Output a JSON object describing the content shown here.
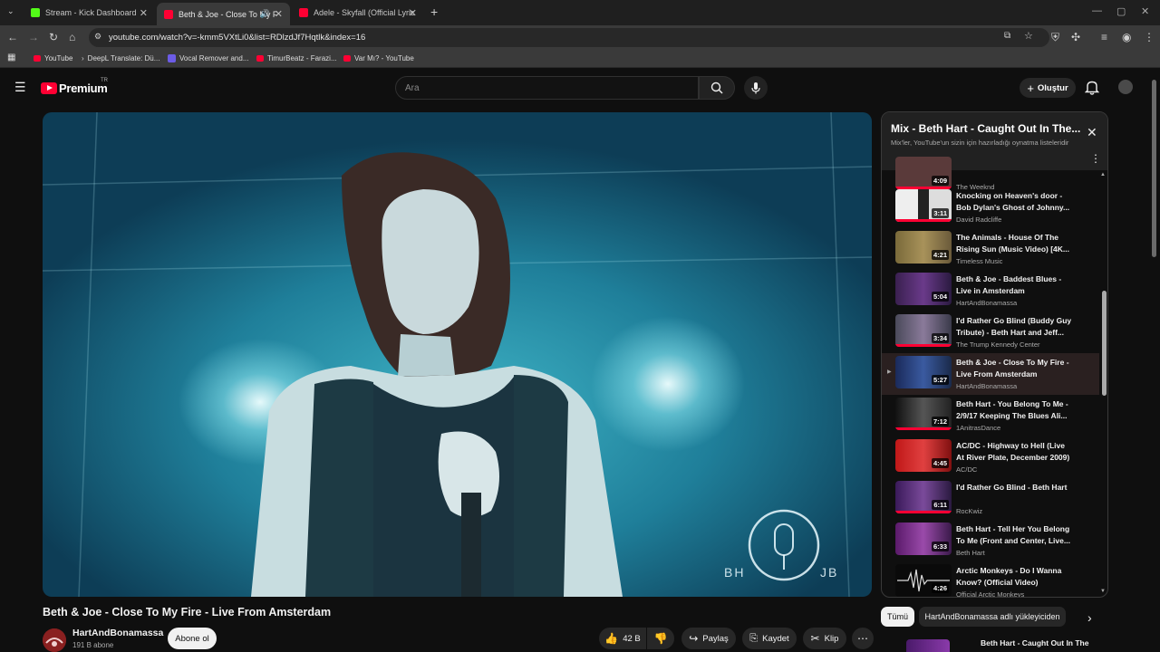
{
  "browser": {
    "tabs": [
      {
        "title": "Stream - Kick Dashboard",
        "favicon_color": "#53fc18"
      },
      {
        "title": "Beth & Joe - Close To My F",
        "favicon_color": "#ff0033"
      },
      {
        "title": "Adele - Skyfall (Official Lyric Vi",
        "favicon_color": "#ff0033"
      }
    ],
    "url": "youtube.com/watch?v=-kmm5VXtLi0&list=RDlzdJf7Hqtlk&index=16",
    "bookmarks": [
      {
        "label": "YouTube"
      },
      {
        "label": "DeepL Translate: Dü..."
      },
      {
        "label": "Vocal Remover and..."
      },
      {
        "label": "TimurBeatz - Farazi..."
      },
      {
        "label": "Var Mı? - YouTube"
      }
    ]
  },
  "header": {
    "logo_text": "Premium",
    "logo_region": "TR",
    "search_placeholder": "Ara",
    "create_label": "Oluştur"
  },
  "video": {
    "title": "Beth & Joe - Close To My Fire - Live From Amsterdam",
    "watermark_left": "BH",
    "watermark_right": "JB",
    "channel_name": "HartAndBonamassa",
    "subscribers": "191 B abone",
    "subscribe_label": "Abone ol",
    "likes": "42 B",
    "share_label": "Paylaş",
    "save_label": "Kaydet",
    "clip_label": "Klip"
  },
  "playlist": {
    "title": "Mix - Beth Hart - Caught Out In The...",
    "subtitle": "Mix'ler, YouTube'un sizin için hazırladığı oynatma listeleridir",
    "items": [
      {
        "title": "",
        "channel": "The Weeknd",
        "duration": "4:09",
        "thumb": "#5a3a3a"
      },
      {
        "title": "Knocking on Heaven's door - Bob Dylan's Ghost of Johnny...",
        "channel": "David Radcliffe",
        "duration": "3:11",
        "thumb": "#bfbfbf"
      },
      {
        "title": "The Animals - House Of The Rising Sun (Music Video) [4K...",
        "channel": "Timeless Music",
        "duration": "4:21",
        "thumb": "#8c7a4a"
      },
      {
        "title": "Beth & Joe - Baddest Blues - Live in Amsterdam",
        "channel": "HartAndBonamassa",
        "duration": "5:04",
        "thumb": "#4a2a5a"
      },
      {
        "title": "I'd Rather Go Blind (Buddy Guy Tribute) - Beth Hart and Jeff...",
        "channel": "The Trump Kennedy Center",
        "duration": "3:34",
        "thumb": "#3a3a4a"
      },
      {
        "title": "Beth & Joe - Close To My Fire - Live From Amsterdam",
        "channel": "HartAndBonamassa",
        "duration": "5:27",
        "thumb": "#2a3a6a",
        "current": true
      },
      {
        "title": "Beth Hart - You Belong To Me - 2/9/17 Keeping The Blues Ali...",
        "channel": "1AnitrasDance",
        "duration": "7:12",
        "thumb": "#2a2a2a"
      },
      {
        "title": "AC/DC - Highway to Hell (Live At River Plate, December 2009)",
        "channel": "AC/DC",
        "duration": "4:45",
        "thumb": "#a02020"
      },
      {
        "title": "I'd Rather Go Blind - Beth Hart",
        "channel": "RocKwiz",
        "duration": "6:11",
        "thumb": "#5a2a6a"
      },
      {
        "title": "Beth Hart - Tell Her You Belong To Me (Front and Center, Live...",
        "channel": "Beth Hart",
        "duration": "6:33",
        "thumb": "#6a2a7a"
      },
      {
        "title": "Arctic Monkeys - Do I Wanna Know? (Official Video)",
        "channel": "Official Arctic Monkeys",
        "duration": "4:26",
        "thumb": "#111111"
      }
    ]
  },
  "chips": [
    {
      "label": "Tümü"
    },
    {
      "label": "HartAndBonamassa adlı yükleyiciden"
    }
  ],
  "recommendation": {
    "title": "Beth Hart - Caught Out In The"
  },
  "colors": {
    "accent": "#ff0033",
    "background": "#0f0f0f"
  }
}
